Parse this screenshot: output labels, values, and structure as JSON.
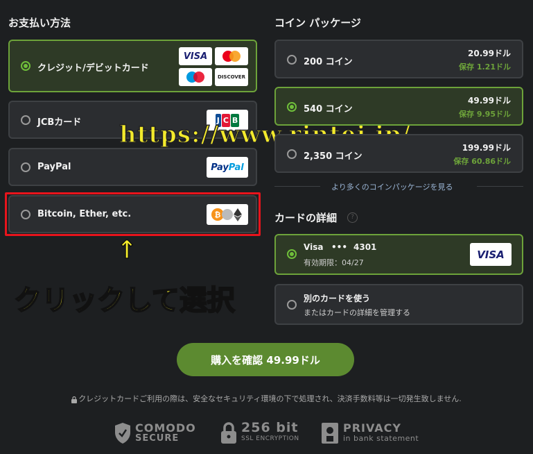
{
  "payment": {
    "heading": "お支払い方法",
    "options": [
      {
        "label": "クレジット/デビットカード"
      },
      {
        "label": "JCBカード"
      },
      {
        "label": "PayPal"
      },
      {
        "label": "Bitcoin, Ether, etc."
      }
    ],
    "logos": {
      "visa": "VISA",
      "discover": "DISCOVER",
      "jcb": "JCB",
      "paypal_a": "Pay",
      "paypal_b": "Pal"
    }
  },
  "coins": {
    "heading": "コイン パッケージ",
    "packages": [
      {
        "label": "200 コイン",
        "price": "20.99ドル",
        "save": "保存 1.21ドル"
      },
      {
        "label": "540 コイン",
        "price": "49.99ドル",
        "save": "保存 9.95ドル"
      },
      {
        "label": "2,350 コイン",
        "price": "199.99ドル",
        "save": "保存 60.86ドル"
      }
    ],
    "more_link": "より多くのコインパッケージを見る"
  },
  "card_details": {
    "heading": "カードの詳細",
    "help_icon": "?",
    "saved_card": {
      "brand": "Visa",
      "dots": "•••",
      "last4": "4301",
      "expiry": "有効期限：04/27",
      "logo": "VISA"
    },
    "other_card": {
      "title": "別のカードを使う",
      "subtitle": "またはカードの詳細を管理する"
    }
  },
  "confirm_button": "購入を確認 49.99ドル",
  "security_note": "クレジットカードご利用の際は、安全なセキュリティ環境の下で処理され、決済手数料等は一切発生致しません.",
  "badges": {
    "comodo_1": "COMODO",
    "comodo_2": "SECURE",
    "ssl_1": "256 bit",
    "ssl_2": "SSL ENCRYPTION",
    "privacy_1": "PRIVACY",
    "privacy_2": "in bank statement"
  },
  "overlay": {
    "url": "https://www.rintei.jp/",
    "arrow": "↑",
    "instruction": "クリックして選択"
  },
  "colors": {
    "accent_green": "#6da33a",
    "highlight_red": "#e8141c",
    "annotation_yellow": "#f7ef2a"
  }
}
